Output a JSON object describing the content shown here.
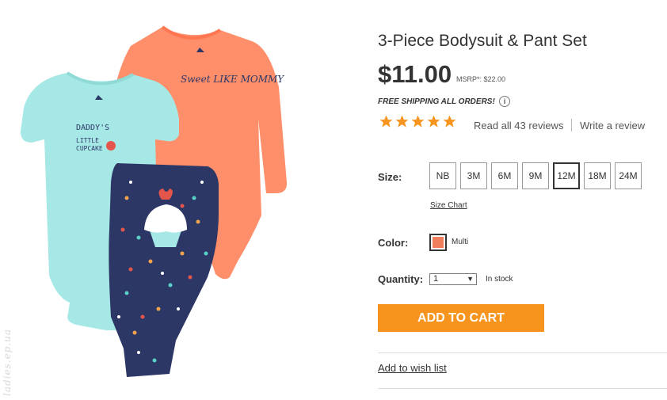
{
  "product": {
    "title": "3-Piece Bodysuit & Pant Set",
    "price": "$11.00",
    "msrp": "MSRP*: $22.00",
    "shipping": "FREE SHIPPING ALL ORDERS!",
    "info_icon": "i",
    "rating": 5,
    "reviews_link": "Read all 43 reviews",
    "write_review": "Write a review",
    "image_alt_texts": {
      "daddy": "DADDY'S LITTLE CUPCAKE",
      "sweet": "Sweet LIKE MOMMY"
    }
  },
  "size": {
    "label": "Size:",
    "options": [
      "NB",
      "3M",
      "6M",
      "9M",
      "12M",
      "18M",
      "24M"
    ],
    "selected": "12M",
    "chart_link": "Size Chart"
  },
  "color": {
    "label": "Color:",
    "name": "Multi",
    "swatch": "#f07d5c"
  },
  "quantity": {
    "label": "Quantity:",
    "value": "1",
    "stock": "In stock"
  },
  "actions": {
    "add_to_cart": "ADD TO CART",
    "wish_list": "Add to wish list"
  },
  "watermark": "ladies.ep.ua",
  "colors": {
    "accent": "#f7941d",
    "star": "#f7941d",
    "mint": "#a6e8e6",
    "coral": "#ff8f6b",
    "navy": "#2c3766"
  }
}
